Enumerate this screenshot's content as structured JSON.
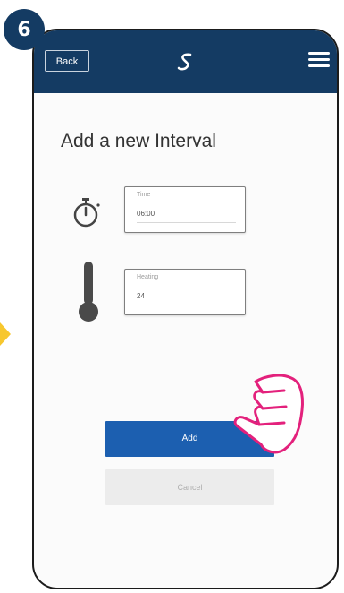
{
  "step": {
    "number": "6"
  },
  "header": {
    "back_label": "Back",
    "logo_icon": "s-logo-icon",
    "menu_icon": "hamburger-menu-icon",
    "bg_color": "#143b63"
  },
  "main": {
    "title": "Add a new Interval",
    "time_field": {
      "label": "Time",
      "value": "06:00",
      "icon": "stopwatch-icon"
    },
    "heating_field": {
      "label": "Heating",
      "value": "24",
      "icon": "thermometer-icon"
    },
    "add_label": "Add",
    "cancel_label": "Cancel",
    "add_color": "#1c5fb0"
  },
  "overlay": {
    "pointer_icon": "pointing-hand-icon",
    "arrow_color": "#f7c72e"
  }
}
